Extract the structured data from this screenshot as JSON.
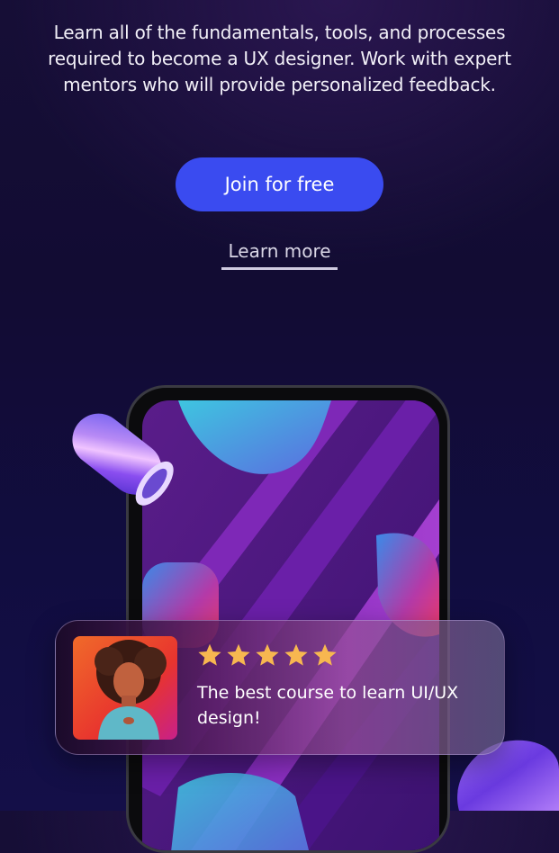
{
  "hero": {
    "description": "Learn all of the fundamentals, tools, and processes required to become a UX designer. Work with expert mentors who will provide personalized feedback.",
    "join_label": "Join for free",
    "learn_more_label": "Learn more"
  },
  "review": {
    "rating": 5,
    "max_rating": 5,
    "text": "The best course to learn UI/UX design!"
  },
  "colors": {
    "primary_button": "#3a4bf0",
    "star": "#f7b750",
    "background": "#130d38"
  },
  "icons": [
    "star-icon",
    "reviewer-avatar",
    "phone-mockup",
    "holographic-tube",
    "holographic-blob"
  ]
}
